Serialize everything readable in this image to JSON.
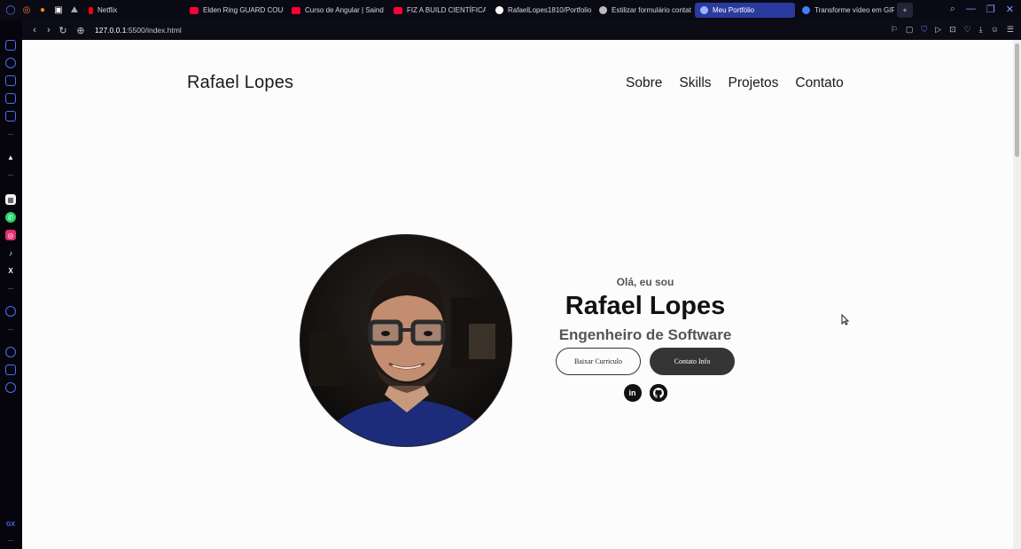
{
  "browser": {
    "tabs": [
      {
        "label": "Netflix",
        "color": "#e50914",
        "active": false
      },
      {
        "label": "Elden Ring GUARD COUN",
        "color": "#ff0033",
        "active": false
      },
      {
        "label": "Curso de Angular | Saind",
        "color": "#ff0033",
        "active": false
      },
      {
        "label": "FIZ A BUILD CIENTÍFICA",
        "color": "#ff0033",
        "active": false
      },
      {
        "label": "RafaelLopes1810/Portfolio",
        "color": "#ffffff",
        "active": false
      },
      {
        "label": "Estilizar formulário contat",
        "color": "#bbbbbb",
        "active": false
      },
      {
        "label": "Meu Portfólio",
        "color": "#9db3ff",
        "active": true
      },
      {
        "label": "Transforme vídeo em GIF",
        "color": "#3b82f6",
        "active": false
      }
    ],
    "new_tab": "+",
    "url_host": "127.0.0.1",
    "url_path": ":5500/index.html"
  },
  "sidebar": {
    "bottom_label": "GX",
    "more": "..."
  },
  "page": {
    "logo": "Rafael Lopes",
    "nav": [
      "Sobre",
      "Skills",
      "Projetos",
      "Contato"
    ],
    "hero": {
      "greeting": "Olá, eu sou",
      "name": "Rafael Lopes",
      "title": "Engenheiro de Software",
      "button_cv": "Baixar Curriculo",
      "button_contact": "Contato Info",
      "linkedin": "in"
    }
  },
  "icons": {
    "linkedin": "linkedin-icon",
    "github": "github-icon",
    "profile": "profile-photo"
  }
}
